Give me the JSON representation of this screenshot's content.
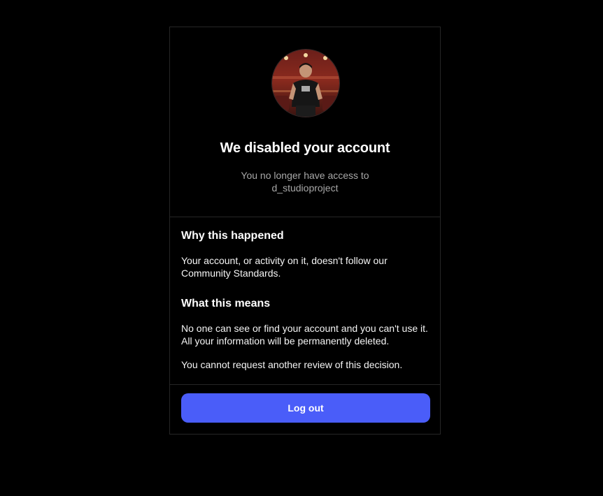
{
  "header": {
    "title": "We disabled your account",
    "subtitle_line1": "You no longer have access to",
    "username": "d_studioproject"
  },
  "why": {
    "heading": "Why this happened",
    "text": "Your account, or activity on it, doesn't follow our Community Standards."
  },
  "means": {
    "heading": "What this means",
    "text": "No one can see or find your account and you can't use it. All your information will be permanently deleted.",
    "review_text": "You cannot request another review of this decision."
  },
  "footer": {
    "logout_label": "Log out"
  },
  "colors": {
    "accent": "#4a5df9",
    "background": "#000000",
    "border": "#262626",
    "muted_text": "#a8a8a8"
  }
}
